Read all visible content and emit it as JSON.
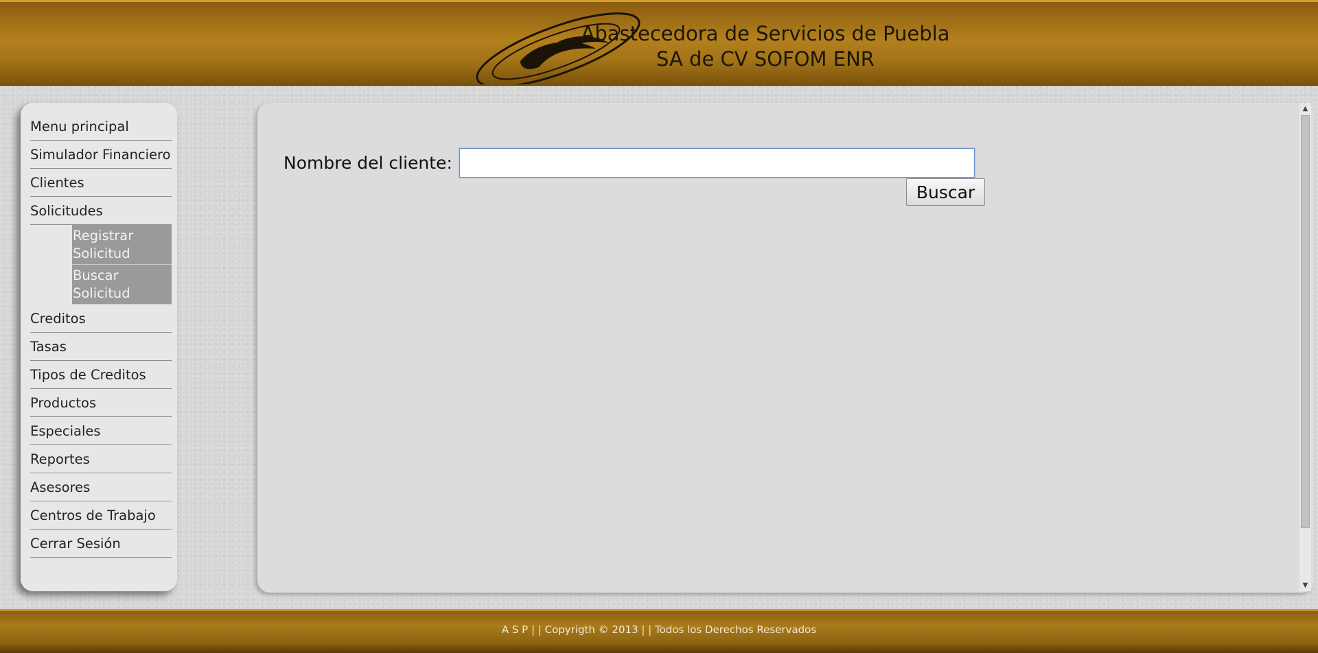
{
  "header": {
    "company_line1": "Abastecedora de Servicios de Puebla",
    "company_line2": "SA de CV SOFOM ENR",
    "logo_icon": "swirl-logo-icon"
  },
  "sidebar": {
    "items": [
      {
        "label": "Menu principal"
      },
      {
        "label": "Simulador Financiero"
      },
      {
        "label": "Clientes"
      },
      {
        "label": "Solicitudes"
      },
      {
        "label": "Creditos"
      },
      {
        "label": "Tasas"
      },
      {
        "label": "Tipos de Creditos"
      },
      {
        "label": "Productos"
      },
      {
        "label": "Especiales"
      },
      {
        "label": "Reportes"
      },
      {
        "label": "Asesores"
      },
      {
        "label": "Centros de Trabajo"
      },
      {
        "label": "Cerrar Sesión"
      }
    ],
    "submenu": [
      {
        "label": "Registrar Solicitud"
      },
      {
        "label": "Buscar Solicitud"
      }
    ]
  },
  "search": {
    "label": "Nombre del cliente:",
    "value": "",
    "placeholder": "",
    "button_label": "Buscar"
  },
  "footer": {
    "text": "A S P  | |  Copyrigth © 2013  | |  Todos los Derechos Reservados"
  },
  "colors": {
    "header_gold": "#b3801d",
    "submenu_bg": "#9a9a9a",
    "panel_bg": "#dcdcdc"
  }
}
